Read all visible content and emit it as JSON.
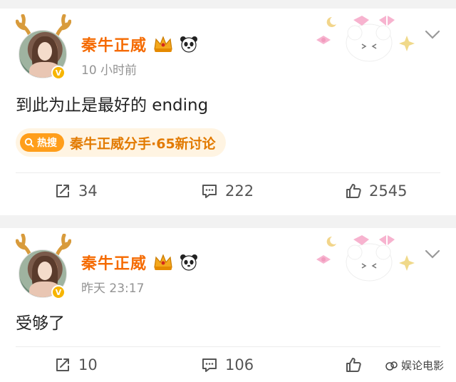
{
  "posts": [
    {
      "username": "秦牛正威",
      "time": "10 小时前",
      "text": "到此为止是最好的 ending",
      "hot_badge": "热搜",
      "hot_topic": "秦牛正威分手·65新讨论",
      "reposts": "34",
      "comments": "222",
      "likes": "2545"
    },
    {
      "username": "秦牛正威",
      "time": "昨天 23:17",
      "text": "受够了",
      "reposts": "10",
      "comments": "106",
      "likes": ""
    }
  ],
  "watermark": "娱论电影",
  "colors": {
    "username": "#f56a00",
    "hot_bg": "#fff4e2",
    "hot_text": "#e27a00",
    "verified": "#f7b500"
  },
  "icons": [
    "repost-icon",
    "comment-icon",
    "like-icon",
    "chevron-down-icon",
    "crown-icon",
    "panda-icon",
    "verified-icon"
  ]
}
